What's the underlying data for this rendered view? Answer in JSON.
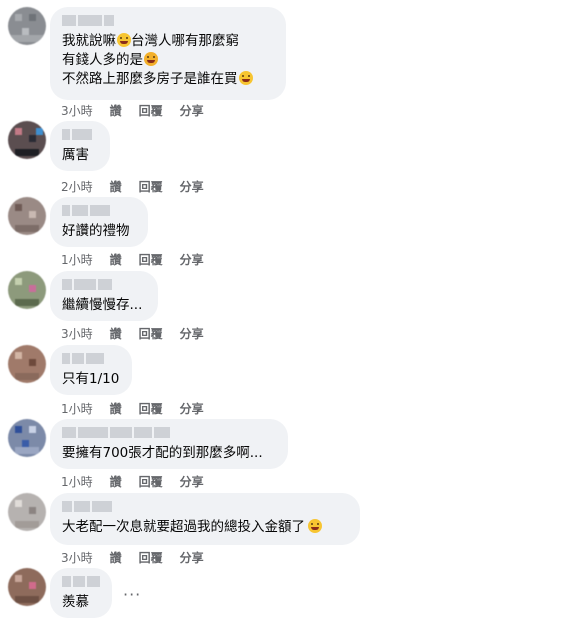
{
  "comments": [
    {
      "text_lines": [
        "我就說嘛",
        "台灣人哪有那麼窮",
        "有錢人多的是",
        "不然路上那麼多房子是誰在買"
      ],
      "time": "3小時",
      "like": "讚",
      "reply": "回覆",
      "share": "分享"
    },
    {
      "text": "厲害",
      "time": "2小時",
      "like": "讚",
      "reply": "回覆",
      "share": "分享"
    },
    {
      "text": "好讚的禮物",
      "time": "1小時",
      "like": "讚",
      "reply": "回覆",
      "share": "分享"
    },
    {
      "text": "繼續慢慢存...",
      "time": "3小時",
      "like": "讚",
      "reply": "回覆",
      "share": "分享"
    },
    {
      "text": "只有1/10",
      "time": "1小時",
      "like": "讚",
      "reply": "回覆",
      "share": "分享"
    },
    {
      "text": "要擁有700張才配的到那麼多啊...",
      "time": "1小時",
      "like": "讚",
      "reply": "回覆",
      "share": "分享"
    },
    {
      "text": "大老配一次息就要超過我的總投入金額了",
      "time": "3小時",
      "like": "讚",
      "reply": "回覆",
      "share": "分享"
    },
    {
      "text": "羨慕",
      "more": "···"
    }
  ],
  "icons": {
    "emoji_1": "laughing-emoji-icon",
    "emoji_2": "rofl-emoji-icon",
    "emoji_3": "tongue-wink-emoji-icon",
    "emoji_4": "sad-sweat-emoji-icon"
  },
  "colors": {
    "bubble": "#f0f2f5",
    "meta": "#65676b",
    "text": "#050505"
  }
}
